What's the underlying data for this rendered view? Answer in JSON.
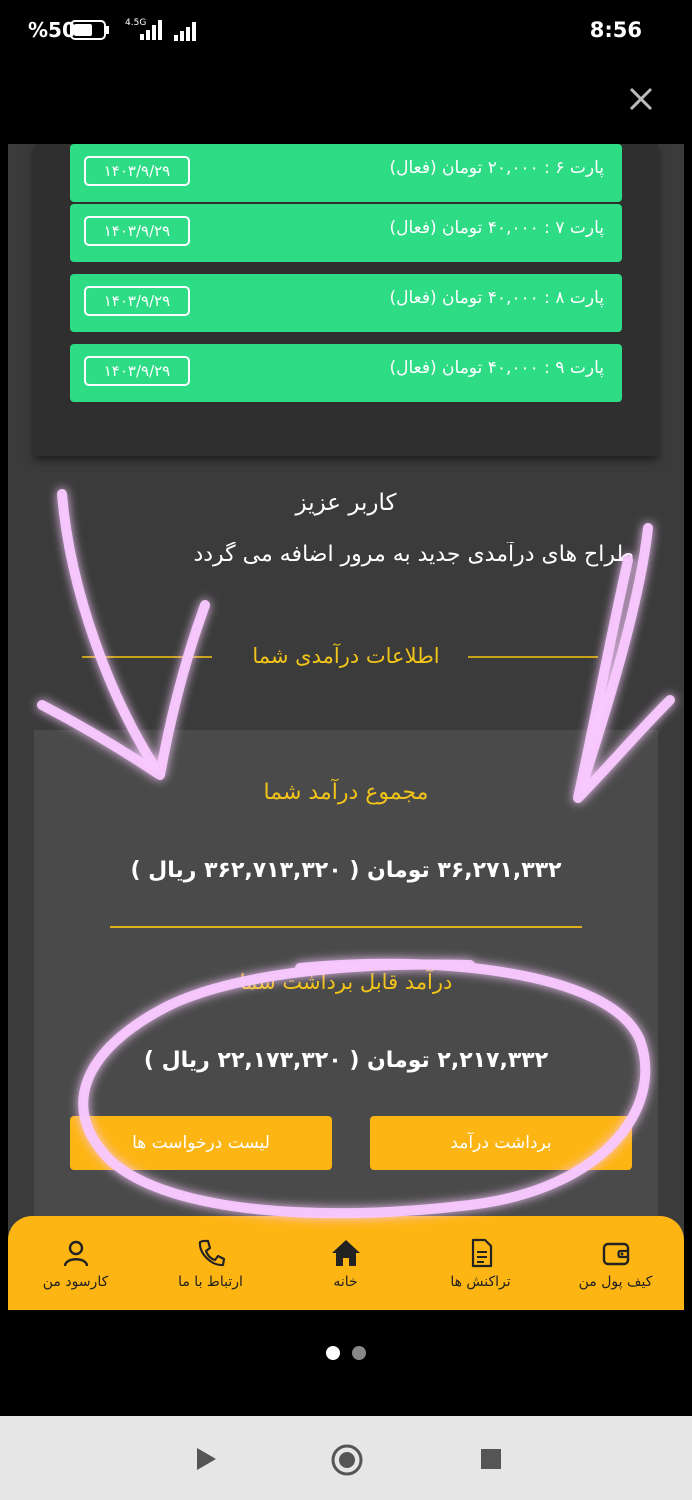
{
  "status": {
    "battery": "%50",
    "network": "4.5G",
    "time": "8:56"
  },
  "parts": [
    {
      "label": "پارت ۶ : ۲۰,۰۰۰ تومان (فعال)",
      "date": "۱۴۰۳/۹/۲۹"
    },
    {
      "label": "پارت ۷ : ۴۰,۰۰۰ تومان (فعال)",
      "date": "۱۴۰۳/۹/۲۹"
    },
    {
      "label": "پارت ۸ : ۴۰,۰۰۰ تومان (فعال)",
      "date": "۱۴۰۳/۹/۲۹"
    },
    {
      "label": "پارت ۹ : ۴۰,۰۰۰ تومان (فعال)",
      "date": "۱۴۰۳/۹/۲۹"
    }
  ],
  "notice": {
    "title": "کاربر عزیز",
    "text": "طراح های درآمدی جدید به مرور اضافه می گردد"
  },
  "income": {
    "header": "اطلاعات درآمدی شما",
    "total_label": "مجموع درآمد شما",
    "total_value": "۳۶,۲۷۱,۳۳۲ تومان ( ۳۶۲,۷۱۳,۳۲۰ ریال )",
    "withdrawable_label": "درآمد قابل برداشت شما",
    "withdrawable_value": "۲,۲۱۷,۳۳۲ تومان ( ۲۲,۱۷۳,۳۲۰ ریال )",
    "withdraw_button": "برداشت درآمد",
    "requests_button": "لیست درخواست ها"
  },
  "nav": [
    {
      "label": "کیف پول من",
      "icon": "wallet-icon"
    },
    {
      "label": "تراکنش ها",
      "icon": "document-icon"
    },
    {
      "label": "خانه",
      "icon": "home-icon"
    },
    {
      "label": "ارتباط با ما",
      "icon": "phone-icon"
    },
    {
      "label": "کارسود من",
      "icon": "user-icon"
    }
  ],
  "colors": {
    "accent": "#fdb514",
    "part_green": "#2fdc86",
    "gold_text": "#f2c318",
    "annotation_magenta": "#e040fb"
  }
}
